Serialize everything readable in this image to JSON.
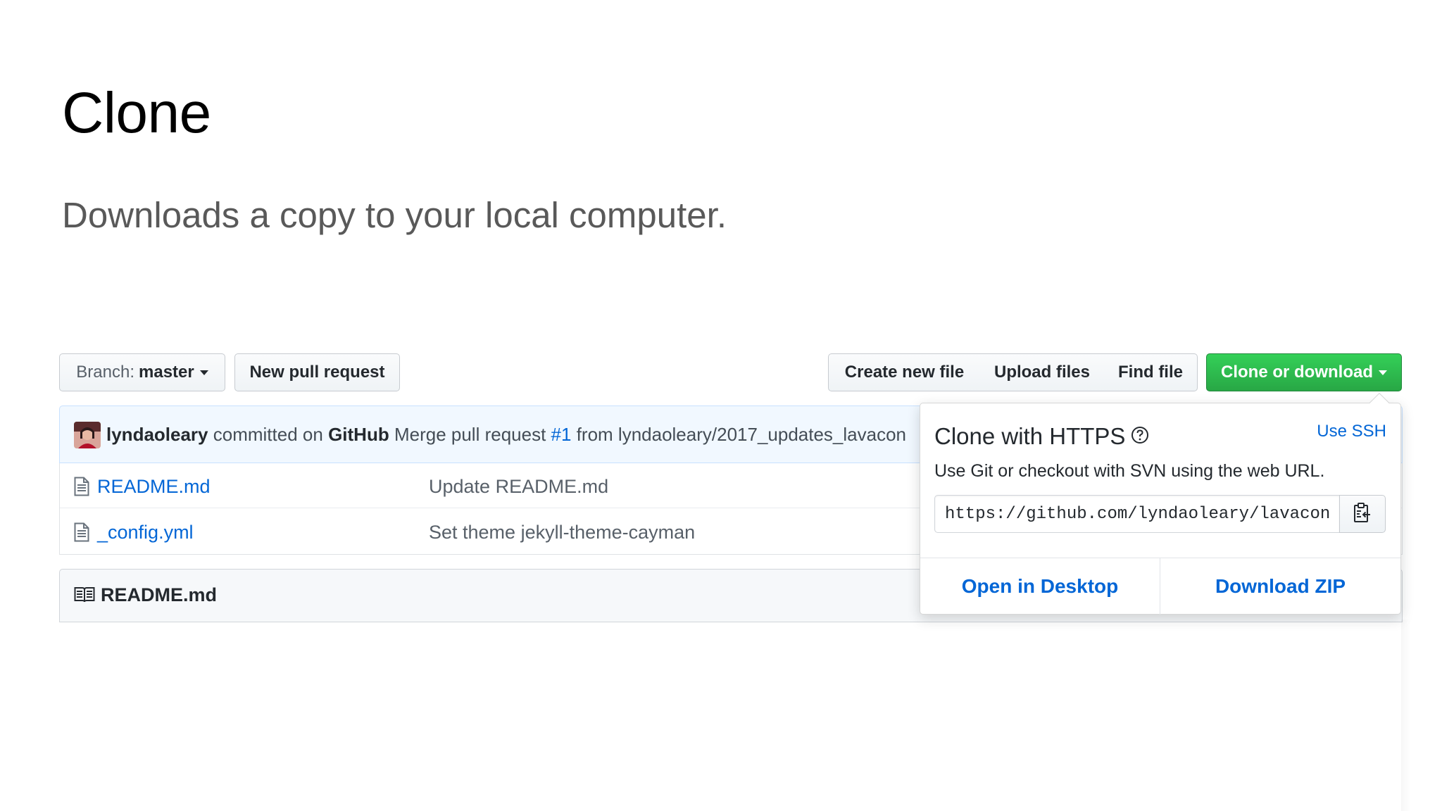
{
  "slide": {
    "title": "Clone",
    "subtitle": "Downloads a copy to your local computer."
  },
  "toolbar": {
    "branch_prefix": "Branch:",
    "branch_name": "master",
    "new_pull_request": "New pull request",
    "create_new_file": "Create new file",
    "upload_files": "Upload files",
    "find_file": "Find file",
    "clone_or_download": "Clone or download"
  },
  "commit": {
    "author": "lyndaoleary",
    "committed_on": "committed on",
    "platform": "GitHub",
    "message_prefix": "Merge pull request",
    "pr_number": "#1",
    "message_suffix": "from lyndaoleary/2017_updates_lavacon"
  },
  "files": [
    {
      "name": "README.md",
      "message": "Update README.md",
      "icon": "file-text-icon"
    },
    {
      "name": "_config.yml",
      "message": "Set theme jekyll-theme-cayman",
      "icon": "file-text-icon"
    }
  ],
  "readme": {
    "title": "README.md",
    "icon": "book-icon"
  },
  "clone_popover": {
    "title": "Clone with HTTPS",
    "use_ssh": "Use SSH",
    "description": "Use Git or checkout with SVN using the web URL.",
    "url": "https://github.com/lyndaoleary/lavacon",
    "open_in_desktop": "Open in Desktop",
    "download_zip": "Download ZIP"
  },
  "colors": {
    "link_blue": "#0366d6",
    "clone_green": "#28a745",
    "commit_bar_bg": "#f1f8ff"
  }
}
